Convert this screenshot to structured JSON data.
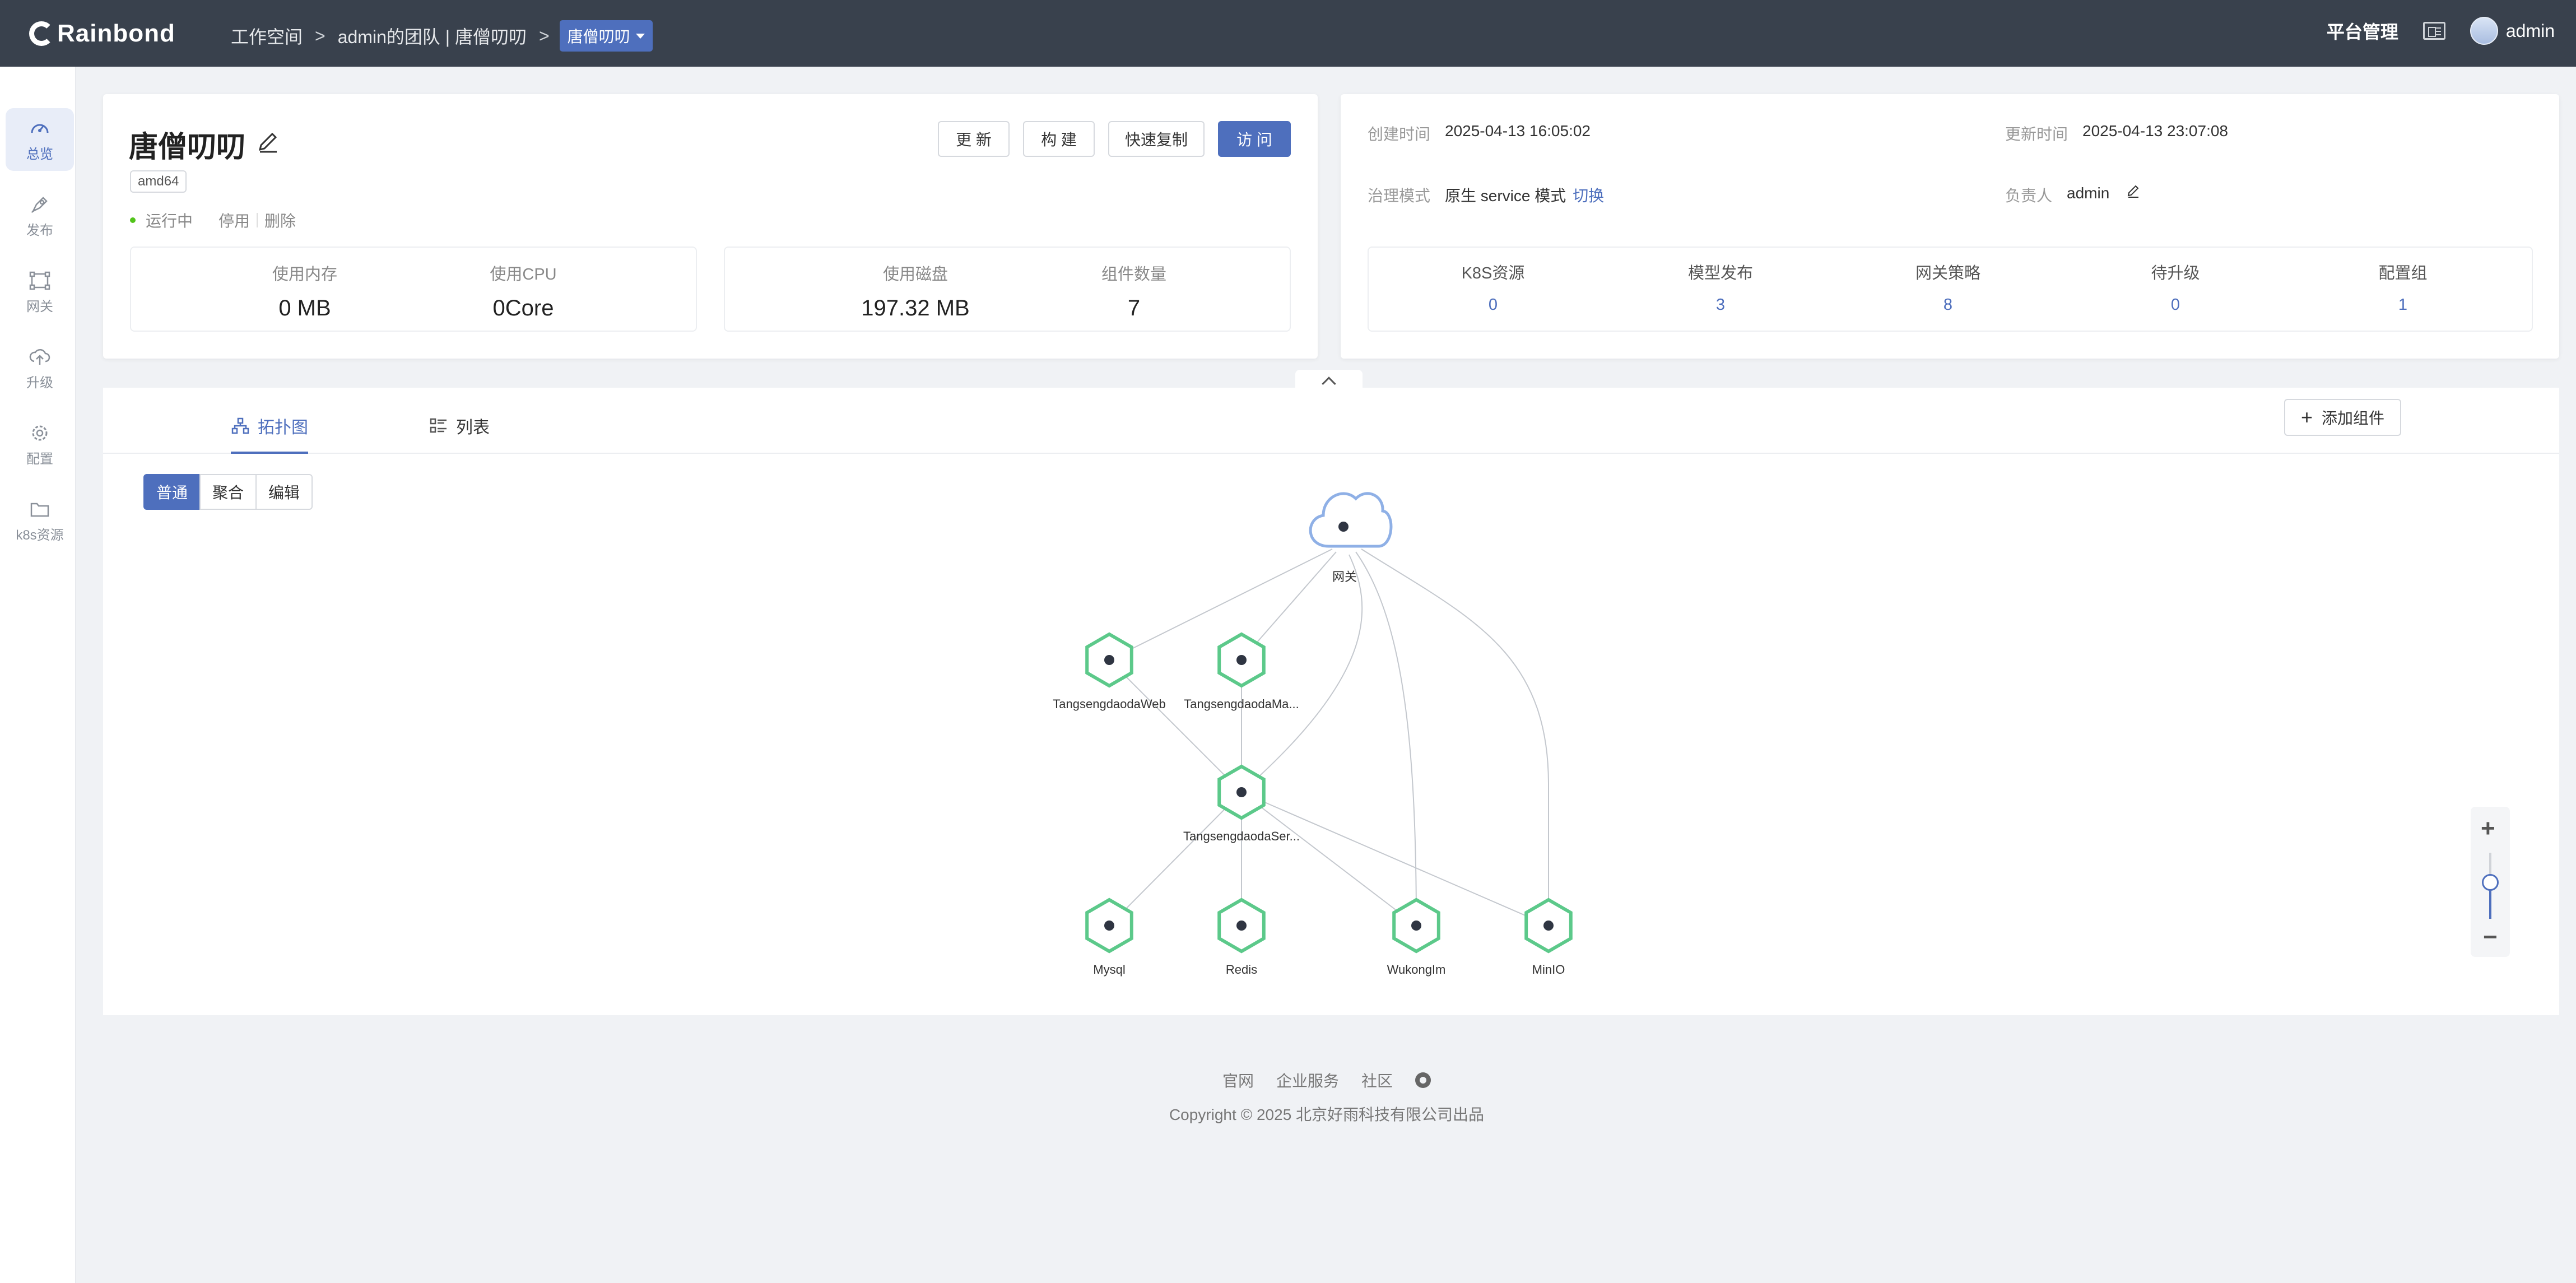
{
  "header": {
    "logo": "Rainbond",
    "breadcrumb": [
      "工作空间",
      "admin的团队 | 唐僧叨叨",
      "唐僧叨叨"
    ],
    "separator": ">",
    "platform": "平台管理",
    "user": "admin"
  },
  "sidebar": {
    "items": [
      {
        "label": "总览",
        "icon": "dashboard-icon",
        "active": true
      },
      {
        "label": "发布",
        "icon": "publish-icon",
        "active": false
      },
      {
        "label": "网关",
        "icon": "gateway-icon",
        "active": false
      },
      {
        "label": "升级",
        "icon": "upgrade-icon",
        "active": false
      },
      {
        "label": "配置",
        "icon": "settings-icon",
        "active": false
      },
      {
        "label": "k8s资源",
        "icon": "folder-icon",
        "active": false
      }
    ]
  },
  "app": {
    "name": "唐僧叨叨",
    "arch": "amd64",
    "status": "运行中",
    "actions": [
      "停用",
      "删除"
    ],
    "buttons": [
      "更 新",
      "构 建",
      "快速复制",
      "访 问"
    ],
    "stats": [
      {
        "label": "使用内存",
        "value": "0 MB"
      },
      {
        "label": "使用CPU",
        "value": "0Core"
      },
      {
        "label": "使用磁盘",
        "value": "197.32 MB"
      },
      {
        "label": "组件数量",
        "value": "7"
      }
    ]
  },
  "meta": {
    "created_label": "创建时间",
    "created": "2025-04-13 16:05:02",
    "updated_label": "更新时间",
    "updated": "2025-04-13 23:07:08",
    "mode_label": "治理模式",
    "mode": "原生 service 模式",
    "switch": "切换",
    "owner_label": "负责人",
    "owner": "admin",
    "resources": [
      {
        "label": "K8S资源",
        "value": "0"
      },
      {
        "label": "模型发布",
        "value": "3"
      },
      {
        "label": "网关策略",
        "value": "8"
      },
      {
        "label": "待升级",
        "value": "0"
      },
      {
        "label": "配置组",
        "value": "1"
      }
    ]
  },
  "topology": {
    "tabs": [
      "拓扑图",
      "列表"
    ],
    "add_button": "添加组件",
    "modes": [
      "普通",
      "聚合",
      "编辑"
    ],
    "gateway": "网关",
    "nodes": [
      {
        "id": "web",
        "label": "TangsengdaodaWeb"
      },
      {
        "id": "ma",
        "label": "TangsengdaodaMa..."
      },
      {
        "id": "ser",
        "label": "TangsengdaodaSer..."
      },
      {
        "id": "mysql",
        "label": "Mysql"
      },
      {
        "id": "redis",
        "label": "Redis"
      },
      {
        "id": "wk",
        "label": "WukongIm"
      },
      {
        "id": "minio",
        "label": "MinIO"
      }
    ],
    "zoom_level": 0.55
  },
  "colors": {
    "header_bg": "#39414d",
    "accent": "#4e6fbd",
    "node_green": "#5cc98a",
    "gateway_blue": "#8fb0e6"
  },
  "footer": {
    "links": [
      "官网",
      "企业服务",
      "社区"
    ],
    "copyright": "Copyright © 2025 北京好雨科技有限公司出品"
  }
}
